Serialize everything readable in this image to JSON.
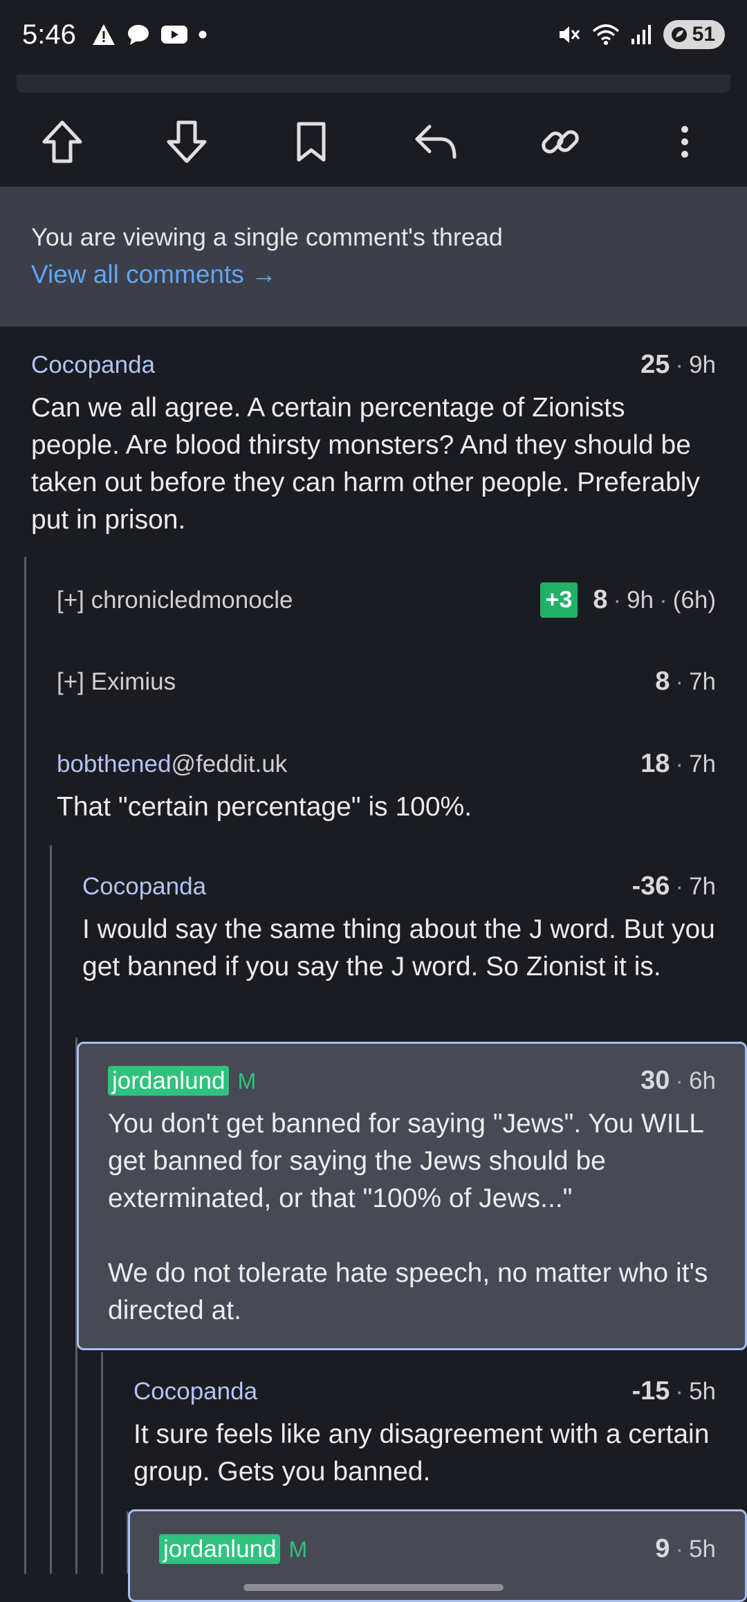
{
  "status_bar": {
    "time": "5:46",
    "battery": "51",
    "icons": [
      "warning-icon",
      "chat-bubble-icon",
      "youtube-icon",
      "dot-icon",
      "mute-icon",
      "wifi-icon",
      "signal-icon",
      "battery-saver-icon"
    ]
  },
  "actions": {
    "icons": [
      "upvote-icon",
      "downvote-icon",
      "bookmark-icon",
      "reply-icon",
      "link-icon",
      "more-icon"
    ]
  },
  "notice": {
    "message": "You are viewing a single comment's thread",
    "link": "View all comments →"
  },
  "comments": [
    {
      "user": "Cocopanda",
      "score": "25",
      "time": "9h",
      "body": "Can we all agree. A certain percentage of Zionists people. Are blood thirsty monsters? And they should be taken out before they can harm other people. Preferably put in prison."
    },
    {
      "user": "[+] chronicledmonocle",
      "badge": "+3",
      "score": "8",
      "time": "9h",
      "edited": "(6h)"
    },
    {
      "user": "[+] Eximius",
      "score": "8",
      "time": "7h"
    },
    {
      "user": "bobthened",
      "host": "@feddit.uk",
      "score": "18",
      "time": "7h",
      "body": "That \"certain percentage\" is 100%."
    },
    {
      "user": "Cocopanda",
      "score": "-36",
      "time": "7h",
      "body": "I would say the same thing about the J word. But you get banned if you say the J word. So Zionist it is."
    },
    {
      "user": "jordanlund",
      "mod": "M",
      "score": "30",
      "time": "6h",
      "body1": "You don't get banned for saying \"Jews\". You WILL get banned for saying the Jews should be exterminated, or that \"100% of Jews...\"",
      "body2": "We do not tolerate hate speech, no matter who it's directed at."
    },
    {
      "user": "Cocopanda",
      "score": "-15",
      "time": "5h",
      "body": "It sure feels like any disagreement with a certain group. Gets you banned."
    },
    {
      "user": "jordanlund",
      "mod": "M",
      "score": "9",
      "time": "5h"
    }
  ],
  "separator": "·"
}
